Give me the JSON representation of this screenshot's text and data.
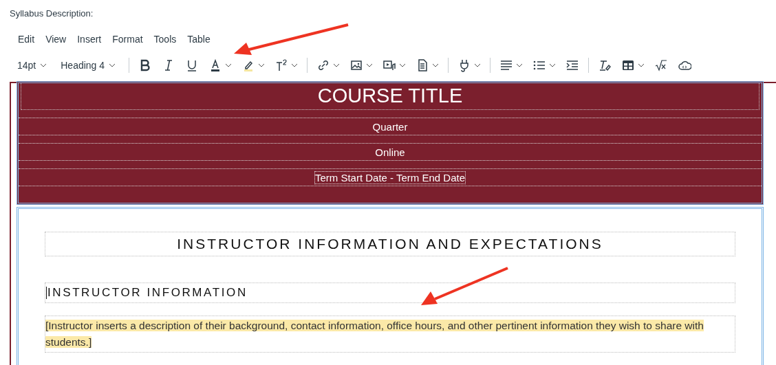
{
  "field_label": "Syllabus Description:",
  "menu": [
    "Edit",
    "View",
    "Insert",
    "Format",
    "Tools",
    "Table"
  ],
  "toolbar": [
    [
      {
        "label": "14pt",
        "dropdown": true
      },
      {
        "label": "Heading 4",
        "dropdown": true
      }
    ],
    [
      {
        "dropdown": false
      },
      {
        "dropdown": false
      },
      {
        "dropdown": false
      },
      {
        "dropdown": true
      },
      {
        "dropdown": true
      },
      {
        "dropdown": true
      }
    ],
    [
      {
        "dropdown": true
      },
      {
        "dropdown": true
      },
      {
        "dropdown": true
      },
      {
        "dropdown": true
      }
    ],
    [
      {
        "dropdown": true
      }
    ],
    [
      {
        "dropdown": true
      },
      {
        "dropdown": true
      },
      {
        "dropdown": false
      }
    ],
    [
      {
        "dropdown": false
      },
      {
        "dropdown": true
      },
      {
        "dropdown": false
      },
      {
        "dropdown": false
      }
    ]
  ],
  "header": {
    "title": "COURSE TITLE",
    "rows": [
      "Quarter",
      "Online",
      "Term Start Date - Term End Date"
    ]
  },
  "section": {
    "heading": "INSTRUCTOR INFORMATION AND EXPECTATIONS",
    "subheading": "INSTRUCTOR INFORMATION",
    "paragraph": {
      "text": "[Instructor inserts a description of their background, contact information, office hours, and other pertinent information they wish to share with students.]",
      "highlighted": true
    }
  }
}
